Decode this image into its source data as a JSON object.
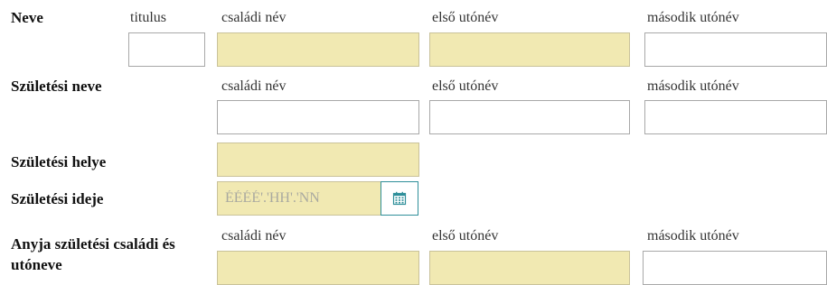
{
  "form": {
    "name": {
      "label": "Neve",
      "title_label": "titulus",
      "family_label": "családi név",
      "first_label": "első utónév",
      "second_label": "második utónév",
      "title_value": "",
      "family_value": "",
      "first_value": "",
      "second_value": ""
    },
    "birth_name": {
      "label": "Születési neve",
      "family_label": "családi név",
      "first_label": "első utónév",
      "second_label": "második utónév",
      "family_value": "",
      "first_value": "",
      "second_value": ""
    },
    "birth_place": {
      "label": "Születési helye",
      "value": ""
    },
    "birth_date": {
      "label": "Születési ideje",
      "placeholder": "ÉÉÉÉ'.'HH'.'NN",
      "value": "",
      "calendar_icon": "calendar-icon"
    },
    "mother_name": {
      "label_line1": "Anyja születési családi és",
      "label_line2": "utóneve",
      "family_label": "családi név",
      "first_label": "első utónév",
      "second_label": "második utónév",
      "family_value": "",
      "first_value": "",
      "second_value": ""
    }
  },
  "colors": {
    "required_field_bg": "#f1e9b2",
    "field_border": "#a8a8a8",
    "calendar_accent": "#2f8f9a"
  }
}
